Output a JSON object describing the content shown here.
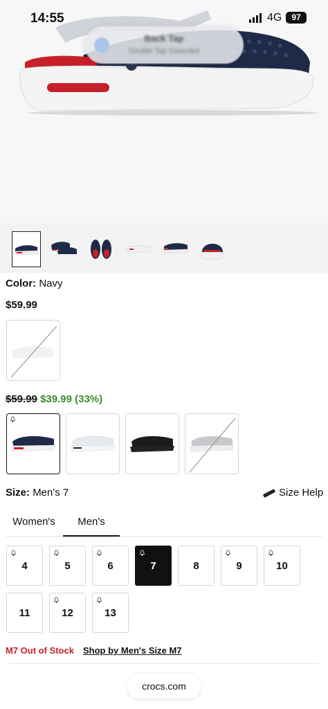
{
  "status_bar": {
    "time": "14:55",
    "network": "4G",
    "battery": "97"
  },
  "banner": {
    "title": "Back Tap",
    "subtitle": "Double Tap Detected"
  },
  "product": {
    "color_label": "Color:",
    "color_value": "Navy",
    "price": "$59.99",
    "price_original": "$59.99",
    "price_sale": "$39.99",
    "discount": "(33%)"
  },
  "thumbnails": [
    "side-view",
    "pair-view",
    "top-view",
    "sole-view",
    "side-view-2",
    "back-view"
  ],
  "colors": {
    "navy": "#1e2a47",
    "red": "#c8202a",
    "sale_green": "#3c8a2e",
    "out_of_stock_red": "#c8202a"
  },
  "swatches": [
    "navy",
    "white",
    "black",
    "gray-unavailable"
  ],
  "size": {
    "label": "Size:",
    "value": "Men's 7",
    "help_label": "Size Help",
    "tabs": [
      {
        "label": "Women's",
        "active": false
      },
      {
        "label": "Men's",
        "active": true
      }
    ],
    "options": [
      {
        "label": "4",
        "notify": true,
        "selected": false
      },
      {
        "label": "5",
        "notify": true,
        "selected": false
      },
      {
        "label": "6",
        "notify": true,
        "selected": false
      },
      {
        "label": "7",
        "notify": true,
        "selected": true
      },
      {
        "label": "8",
        "notify": false,
        "selected": false
      },
      {
        "label": "9",
        "notify": true,
        "selected": false
      },
      {
        "label": "10",
        "notify": true,
        "selected": false
      },
      {
        "label": "11",
        "notify": false,
        "selected": false
      },
      {
        "label": "12",
        "notify": true,
        "selected": false
      },
      {
        "label": "13",
        "notify": true,
        "selected": false
      }
    ]
  },
  "stock": {
    "message": "M7 Out of Stock",
    "link": "Shop by Men's Size M7"
  },
  "browser": {
    "url": "crocs.com"
  }
}
